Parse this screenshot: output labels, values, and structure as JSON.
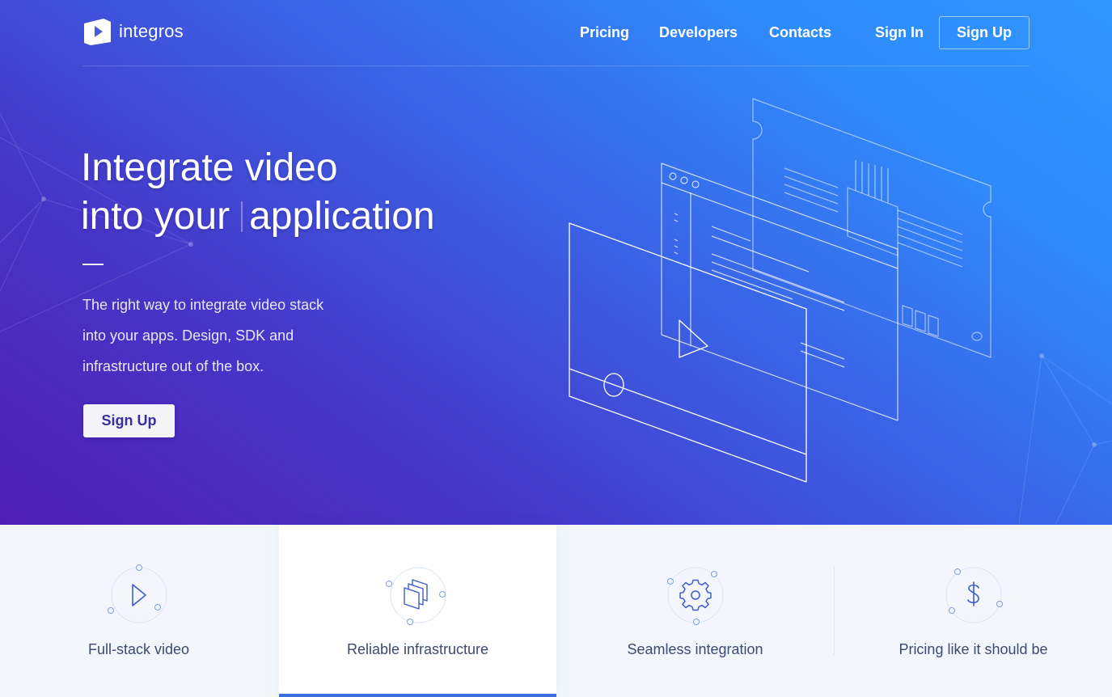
{
  "brand": {
    "name": "integros"
  },
  "nav": {
    "items": [
      {
        "label": "Pricing"
      },
      {
        "label": "Developers"
      },
      {
        "label": "Contacts"
      }
    ],
    "sign_in": "Sign In",
    "sign_up": "Sign Up"
  },
  "hero": {
    "title_line1": "Integrate video",
    "title_line2_prefix": "into your",
    "title_line2_word": "application",
    "description": "The right way to integrate video stack into your apps. Design, SDK and infrastructure out of the box.",
    "cta_label": "Sign Up"
  },
  "features": [
    {
      "label": "Full-stack video",
      "icon": "play-icon"
    },
    {
      "label": "Reliable infrastructure",
      "icon": "layers-icon",
      "active": true
    },
    {
      "label": "Seamless integration",
      "icon": "gear-icon"
    },
    {
      "label": "Pricing like it should be",
      "icon": "dollar-icon"
    }
  ],
  "colors": {
    "gradient_start": "#4f1fb4",
    "gradient_end": "#2f96ff",
    "active_accent": "#3b6fe0",
    "feature_text": "#3a4a72"
  }
}
